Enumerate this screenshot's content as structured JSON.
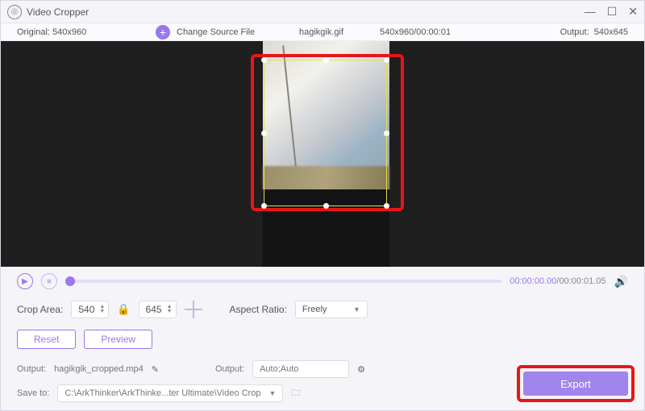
{
  "window": {
    "title": "Video Cropper"
  },
  "infobar": {
    "original_label": "Original:",
    "original_value": "540x960",
    "change_source": "Change Source File",
    "filename": "hagikgik.gif",
    "source_dims_time": "540x960/00:00:01",
    "output_label": "Output:",
    "output_value": "540x645"
  },
  "player": {
    "current_time": "00:00:00.00",
    "total_time": "00:00:01.05"
  },
  "crop": {
    "area_label": "Crop Area:",
    "width": "540",
    "height": "645",
    "aspect_label": "Aspect Ratio:",
    "aspect_value": "Freely"
  },
  "buttons": {
    "reset": "Reset",
    "preview": "Preview",
    "export": "Export"
  },
  "output": {
    "file_label": "Output:",
    "file_value": "hagikgik_cropped.mp4",
    "settings_label": "Output:",
    "settings_value": "Auto;Auto",
    "save_label": "Save to:",
    "save_path": "C:\\ArkThinker\\ArkThinke...ter Ultimate\\Video Crop"
  }
}
